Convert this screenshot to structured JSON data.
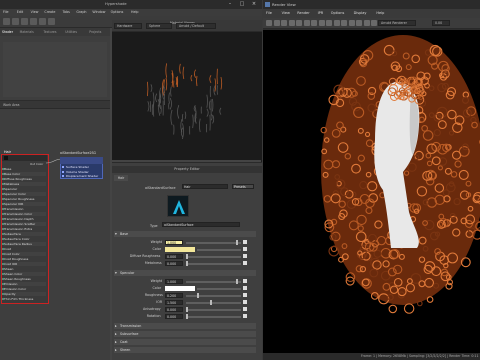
{
  "hypershade": {
    "title": "Hypershade",
    "menus": [
      "File",
      "Edit",
      "View",
      "Create",
      "Tabs",
      "Graph",
      "Window",
      "Options",
      "Help"
    ],
    "browser_tabs": [
      "Shader",
      "Materials",
      "Textures",
      "Utilities",
      "Projects",
      "Scroll Delete"
    ],
    "preview": {
      "title": "Material Viewer",
      "renderer": "Hardware",
      "shape": "Sphere",
      "env": "Arnold / Default"
    },
    "graph_label": "Work Area",
    "hair_node": {
      "title": "Hair",
      "out_label": "Out Color",
      "attrs": [
        "Base",
        "Base Color",
        "Diffuse Roughness",
        "Metalness",
        "Specular",
        "Specular Color",
        "Specular Roughness",
        "Specular IOR",
        "Transmission",
        "Transmission Color",
        "Transmission Depth",
        "Transmission Scatter",
        "Transmission Extra Roughness",
        "Subsurface",
        "Subsurface Color",
        "Subsurface Radius",
        "Coat",
        "Coat Color",
        "Coat Roughness",
        "Coat IOR",
        "Sheen",
        "Sheen Color",
        "Sheen Roughness",
        "Emission",
        "Emission Color",
        "Opacity",
        "Thin Film Thickness"
      ]
    },
    "surface_node": {
      "title": "aiStandardSurface2SG",
      "rows": [
        "Surface Shader",
        "Volume Shader",
        "Displacement Shader"
      ]
    }
  },
  "property_editor": {
    "title": "Property Editor",
    "tab": "Hair",
    "type_label": "aiStandardSurface",
    "name_value": "Hair",
    "presets_label": "Presets",
    "type_row_label": "Type",
    "type_value": "aiStandardSurface",
    "sections": [
      {
        "label": "Base",
        "open": true,
        "rows": [
          {
            "label": "Weight",
            "value": "1.000",
            "fill": 0.95
          },
          {
            "label": "Color",
            "value": "",
            "swatch": "#f3e79a"
          },
          {
            "label": "Diffuse Roughness",
            "value": "0.000",
            "fill": 0.0
          },
          {
            "label": "Metalness",
            "value": "0.000",
            "fill": 0.0
          }
        ]
      },
      {
        "label": "Specular",
        "open": true,
        "rows": [
          {
            "label": "Weight",
            "value": "1.000",
            "fill": 0.95
          },
          {
            "label": "Color",
            "value": "",
            "swatch": "#ffffff"
          },
          {
            "label": "Roughness",
            "value": "0.200",
            "fill": 0.2
          },
          {
            "label": "IOR",
            "value": "1.500",
            "fill": 0.45
          },
          {
            "label": "Anisotropy",
            "value": "0.000",
            "fill": 0.0
          },
          {
            "label": "Rotation",
            "value": "0.000",
            "fill": 0.0
          }
        ]
      }
    ],
    "collapsed_sections": [
      "Transmission",
      "Subsurface",
      "Coat",
      "Sheen",
      "Emission"
    ]
  },
  "render_view": {
    "title": "Render View",
    "menus": [
      "File",
      "View",
      "Render",
      "IPR",
      "Options",
      "Display",
      "Help"
    ],
    "camera_dropdown": "persp",
    "renderer_dropdown": "Arnold Renderer",
    "exposure": "0.00",
    "status": "Frame: 1 | Memory: 2658Mb | Sampling: [3/2/2/2/2/2] | Render Time: 0:11"
  },
  "colors": {
    "hair_node_border": "#cc2222",
    "surface_node": "#3a4a86",
    "hair_color": "#b85a24"
  }
}
